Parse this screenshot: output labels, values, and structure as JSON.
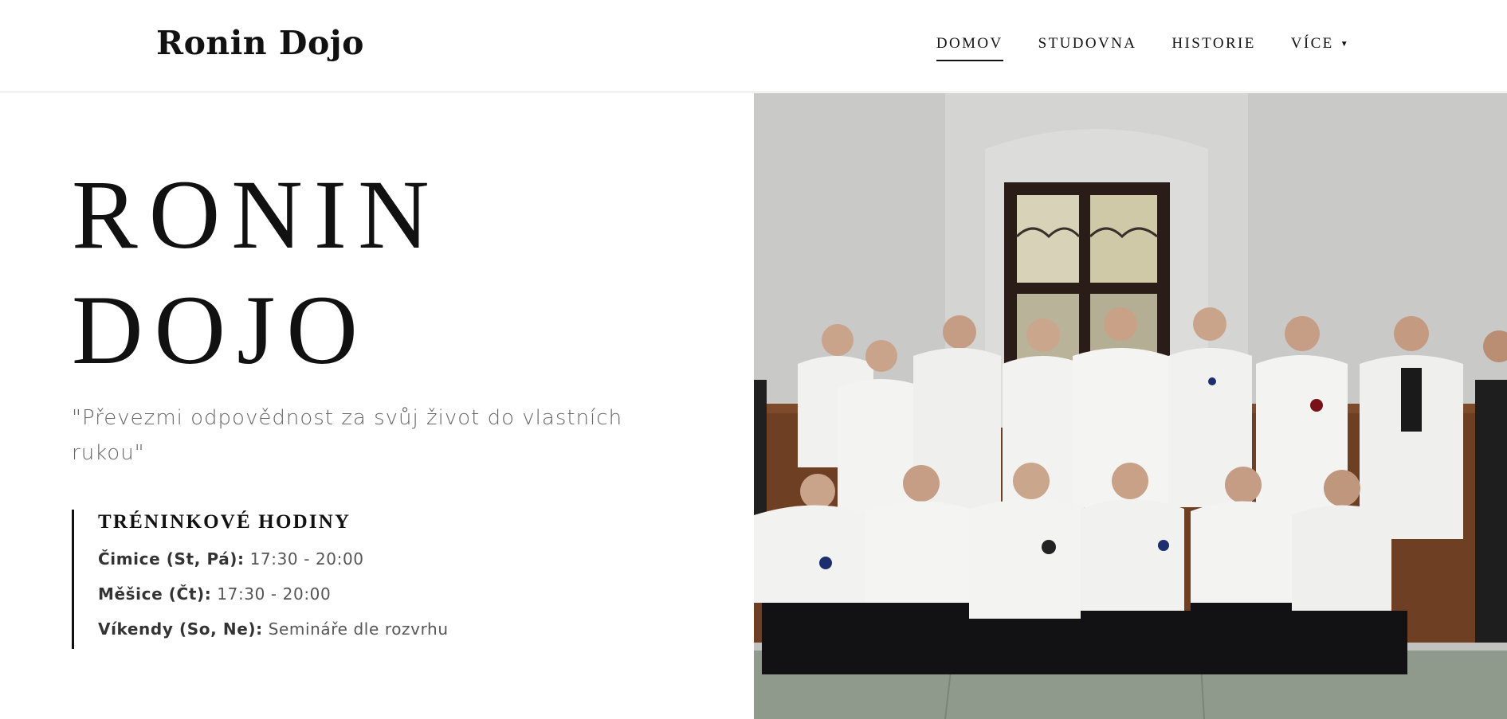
{
  "header": {
    "brand": "Ronin Dojo",
    "nav": [
      {
        "label": "DOMOV",
        "active": true
      },
      {
        "label": "STUDOVNA",
        "active": false
      },
      {
        "label": "HISTORIE",
        "active": false
      },
      {
        "label": "VÍCE",
        "active": false,
        "icon": "caret-down-icon"
      }
    ]
  },
  "hero": {
    "title_line1": "RONIN",
    "title_line2": "DOJO",
    "quote": "\"Převezmi odpovědnost za svůj život do vlastních rukou\"",
    "hours": {
      "heading": "TRÉNINKOVÉ HODINY",
      "rows": [
        {
          "label": "Čimice (St, Pá):",
          "value": "17:30 - 20:00"
        },
        {
          "label": "Měšice (Čt):",
          "value": "17:30 - 20:00"
        },
        {
          "label": "Víkendy (So, Ne):",
          "value": "Semináře dle rozvrhu"
        }
      ]
    }
  },
  "colors": {
    "text": "#111111",
    "muted": "#666666",
    "gi_white": "#f2f2f0",
    "hakama": "#121214",
    "wall": "#c4c4c2",
    "floor": "#8f9a8c"
  }
}
